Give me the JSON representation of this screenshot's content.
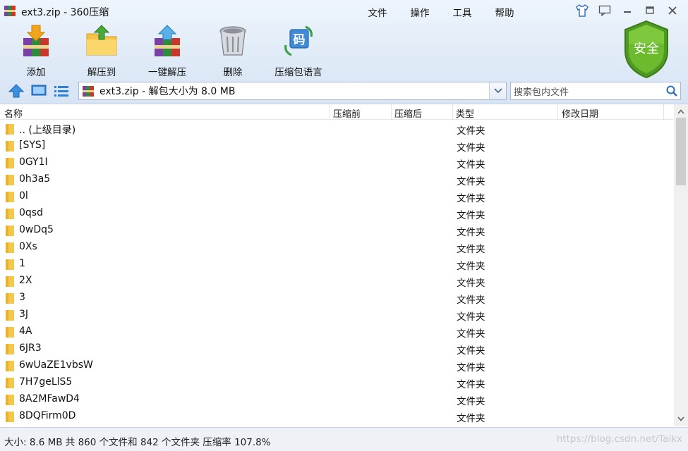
{
  "window": {
    "title": "ext3.zip - 360压缩",
    "menu": [
      "文件",
      "操作",
      "工具",
      "帮助"
    ],
    "app_icon": "winrar-books-icon"
  },
  "toolbar": {
    "add_label": "添加",
    "extract_to_label": "解压到",
    "one_click_extract_label": "一键解压",
    "delete_label": "删除",
    "archive_language_label": "压缩包语言",
    "language_icon_char": "码"
  },
  "safety_badge": {
    "label": "安全",
    "color": "#4f9a22"
  },
  "address": {
    "path": "ext3.zip - 解包大小为 8.0 MB",
    "search_placeholder": "搜索包内文件"
  },
  "columns": {
    "name": "名称",
    "before": "压缩前",
    "after": "压缩后",
    "type": "类型",
    "modified": "修改日期"
  },
  "files": [
    {
      "name": ".. (上级目录)",
      "type": "文件夹"
    },
    {
      "name": "[SYS]",
      "type": "文件夹"
    },
    {
      "name": "0GY1I",
      "type": "文件夹"
    },
    {
      "name": "0h3a5",
      "type": "文件夹"
    },
    {
      "name": "0l",
      "type": "文件夹"
    },
    {
      "name": "0qsd",
      "type": "文件夹"
    },
    {
      "name": "0wDq5",
      "type": "文件夹"
    },
    {
      "name": "0Xs",
      "type": "文件夹"
    },
    {
      "name": "1",
      "type": "文件夹"
    },
    {
      "name": "2X",
      "type": "文件夹"
    },
    {
      "name": "3",
      "type": "文件夹"
    },
    {
      "name": "3J",
      "type": "文件夹"
    },
    {
      "name": "4A",
      "type": "文件夹"
    },
    {
      "name": "6JR3",
      "type": "文件夹"
    },
    {
      "name": "6wUaZE1vbsW",
      "type": "文件夹"
    },
    {
      "name": "7H7geLlS5",
      "type": "文件夹"
    },
    {
      "name": "8A2MFawD4",
      "type": "文件夹"
    },
    {
      "name": "8DQFirm0D",
      "type": "文件夹"
    }
  ],
  "status": {
    "text": "大小: 8.6 MB 共 860 个文件和 842 个文件夹 压缩率 107.8%",
    "watermark": "https://blog.csdn.net/Taikx"
  },
  "colors": {
    "folder": "#f4c84a",
    "accent_blue": "#2d7fd3",
    "header_bg": "#dfeaf7"
  }
}
